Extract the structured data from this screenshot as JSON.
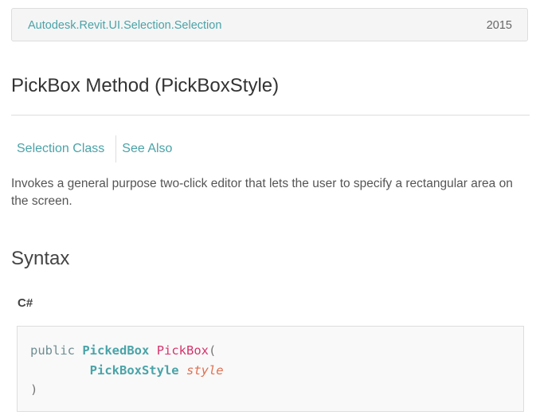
{
  "breadcrumb": {
    "path": "Autodesk.Revit.UI.Selection.Selection",
    "version": "2015"
  },
  "page": {
    "title": "PickBox Method (PickBoxStyle)"
  },
  "nav": {
    "items": [
      {
        "label": "Selection Class"
      },
      {
        "label": "See Also"
      }
    ]
  },
  "summary": "Invokes a general purpose two-click editor that lets the user to specify a rectangular area on the screen.",
  "syntax": {
    "heading": "Syntax",
    "language": "C#",
    "code": {
      "keyword": "public",
      "return_type": "PickedBox",
      "method_name": "PickBox",
      "open_paren": "(",
      "param_type": "PickBoxStyle",
      "param_name": "style",
      "close_paren": ")"
    }
  },
  "colors": {
    "link": "#4aa3a8",
    "method": "#d6336c",
    "param": "#e07050",
    "code_background": "#f9f9f9"
  }
}
